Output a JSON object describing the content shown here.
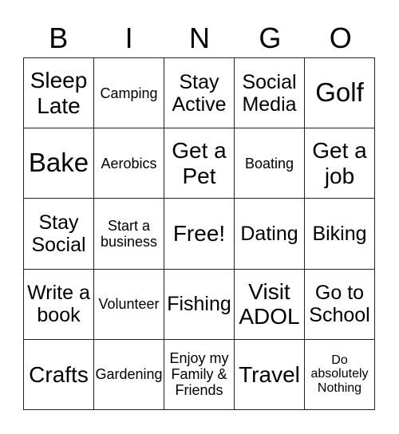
{
  "header": [
    "B",
    "I",
    "N",
    "G",
    "O"
  ],
  "cells": [
    [
      "Sleep Late",
      "Camping",
      "Stay Active",
      "Social Media",
      "Golf"
    ],
    [
      "Bake",
      "Aerobics",
      "Get a Pet",
      "Boating",
      "Get a job"
    ],
    [
      "Stay Social",
      "Start a business",
      "Free!",
      "Dating",
      "Biking"
    ],
    [
      "Write a book",
      "Volunteer",
      "Fishing",
      "Visit ADOL",
      "Go to School"
    ],
    [
      "Crafts",
      "Gardening",
      "Enjoy my Family & Friends",
      "Travel",
      "Do absolutely Nothing"
    ]
  ]
}
